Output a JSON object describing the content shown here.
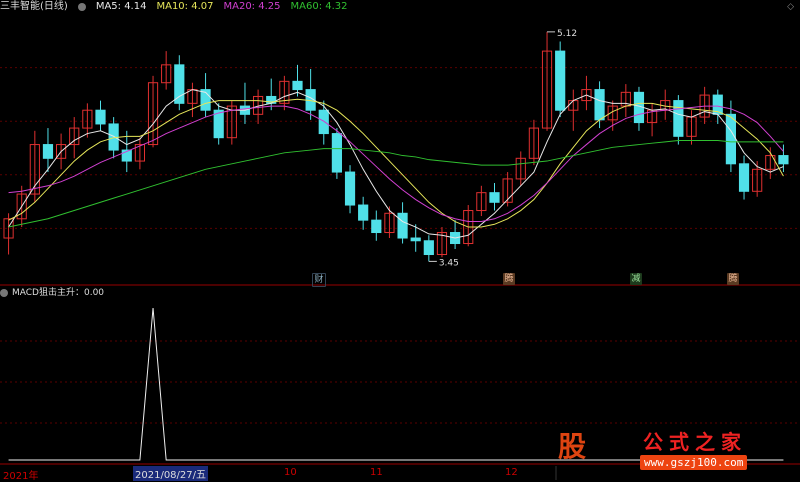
{
  "header": {
    "title": "三丰智能(日线)",
    "ma": [
      {
        "label": "MA5: 4.14",
        "color": "#e8e8e8"
      },
      {
        "label": "MA10: 4.07",
        "color": "#e6e65a"
      },
      {
        "label": "MA20: 4.25",
        "color": "#d040d0"
      },
      {
        "label": "MA60: 4.32",
        "color": "#30c030"
      }
    ]
  },
  "indicator_header": "MACD狙击主升：0.00",
  "markers": [
    "财",
    "腾",
    "减",
    "腾"
  ],
  "x_axis": {
    "labels": [
      "2021年",
      "10",
      "11",
      "12"
    ],
    "selected": "2021/08/27/五"
  },
  "price_annotations": {
    "high": "5.12",
    "low": "3.45"
  },
  "watermark": {
    "logo": "股",
    "title": "公式之家",
    "url": "www.gszj100.com"
  },
  "colors": {
    "up": "#e03030",
    "down": "#50e0e8",
    "bg": "#000000",
    "grid": "#5a0000"
  },
  "chart_data": [
    {
      "type": "candlestick",
      "title": "三丰智能(日线)",
      "ylim": [
        3.3,
        5.25
      ],
      "candles": [
        {
          "o": 3.62,
          "h": 3.8,
          "l": 3.5,
          "c": 3.76
        },
        {
          "o": 3.76,
          "h": 4.0,
          "l": 3.7,
          "c": 3.94
        },
        {
          "o": 3.94,
          "h": 4.4,
          "l": 3.88,
          "c": 4.3
        },
        {
          "o": 4.3,
          "h": 4.42,
          "l": 4.1,
          "c": 4.2
        },
        {
          "o": 4.2,
          "h": 4.38,
          "l": 4.12,
          "c": 4.3
        },
        {
          "o": 4.3,
          "h": 4.5,
          "l": 4.2,
          "c": 4.42
        },
        {
          "o": 4.42,
          "h": 4.6,
          "l": 4.35,
          "c": 4.55
        },
        {
          "o": 4.55,
          "h": 4.62,
          "l": 4.4,
          "c": 4.45
        },
        {
          "o": 4.45,
          "h": 4.5,
          "l": 4.2,
          "c": 4.26
        },
        {
          "o": 4.26,
          "h": 4.4,
          "l": 4.1,
          "c": 4.18
        },
        {
          "o": 4.18,
          "h": 4.35,
          "l": 4.12,
          "c": 4.3
        },
        {
          "o": 4.3,
          "h": 4.8,
          "l": 4.28,
          "c": 4.75
        },
        {
          "o": 4.75,
          "h": 4.98,
          "l": 4.7,
          "c": 4.88
        },
        {
          "o": 4.88,
          "h": 4.95,
          "l": 4.55,
          "c": 4.6
        },
        {
          "o": 4.6,
          "h": 4.75,
          "l": 4.5,
          "c": 4.7
        },
        {
          "o": 4.7,
          "h": 4.82,
          "l": 4.5,
          "c": 4.55
        },
        {
          "o": 4.55,
          "h": 4.6,
          "l": 4.3,
          "c": 4.35
        },
        {
          "o": 4.35,
          "h": 4.62,
          "l": 4.3,
          "c": 4.58
        },
        {
          "o": 4.58,
          "h": 4.75,
          "l": 4.45,
          "c": 4.52
        },
        {
          "o": 4.52,
          "h": 4.7,
          "l": 4.45,
          "c": 4.65
        },
        {
          "o": 4.65,
          "h": 4.78,
          "l": 4.55,
          "c": 4.6
        },
        {
          "o": 4.6,
          "h": 4.8,
          "l": 4.55,
          "c": 4.76
        },
        {
          "o": 4.76,
          "h": 4.88,
          "l": 4.65,
          "c": 4.7
        },
        {
          "o": 4.7,
          "h": 4.85,
          "l": 4.48,
          "c": 4.55
        },
        {
          "o": 4.55,
          "h": 4.62,
          "l": 4.3,
          "c": 4.38
        },
        {
          "o": 4.38,
          "h": 4.42,
          "l": 4.05,
          "c": 4.1
        },
        {
          "o": 4.1,
          "h": 4.15,
          "l": 3.8,
          "c": 3.86
        },
        {
          "o": 3.86,
          "h": 3.92,
          "l": 3.68,
          "c": 3.75
        },
        {
          "o": 3.75,
          "h": 3.82,
          "l": 3.6,
          "c": 3.66
        },
        {
          "o": 3.66,
          "h": 3.85,
          "l": 3.62,
          "c": 3.8
        },
        {
          "o": 3.8,
          "h": 3.88,
          "l": 3.58,
          "c": 3.62
        },
        {
          "o": 3.62,
          "h": 3.72,
          "l": 3.52,
          "c": 3.6
        },
        {
          "o": 3.6,
          "h": 3.64,
          "l": 3.45,
          "c": 3.5
        },
        {
          "o": 3.5,
          "h": 3.7,
          "l": 3.48,
          "c": 3.66
        },
        {
          "o": 3.66,
          "h": 3.75,
          "l": 3.54,
          "c": 3.58
        },
        {
          "o": 3.58,
          "h": 3.86,
          "l": 3.56,
          "c": 3.82
        },
        {
          "o": 3.82,
          "h": 4.0,
          "l": 3.78,
          "c": 3.95
        },
        {
          "o": 3.95,
          "h": 4.02,
          "l": 3.82,
          "c": 3.88
        },
        {
          "o": 3.88,
          "h": 4.1,
          "l": 3.85,
          "c": 4.05
        },
        {
          "o": 4.05,
          "h": 4.25,
          "l": 4.0,
          "c": 4.2
        },
        {
          "o": 4.2,
          "h": 4.48,
          "l": 4.15,
          "c": 4.42
        },
        {
          "o": 4.42,
          "h": 5.12,
          "l": 4.4,
          "c": 4.98
        },
        {
          "o": 4.98,
          "h": 5.05,
          "l": 4.5,
          "c": 4.55
        },
        {
          "o": 4.55,
          "h": 4.7,
          "l": 4.4,
          "c": 4.62
        },
        {
          "o": 4.62,
          "h": 4.8,
          "l": 4.55,
          "c": 4.7
        },
        {
          "o": 4.7,
          "h": 4.76,
          "l": 4.42,
          "c": 4.48
        },
        {
          "o": 4.48,
          "h": 4.62,
          "l": 4.4,
          "c": 4.58
        },
        {
          "o": 4.58,
          "h": 4.74,
          "l": 4.5,
          "c": 4.68
        },
        {
          "o": 4.68,
          "h": 4.72,
          "l": 4.4,
          "c": 4.46
        },
        {
          "o": 4.46,
          "h": 4.6,
          "l": 4.36,
          "c": 4.55
        },
        {
          "o": 4.55,
          "h": 4.7,
          "l": 4.48,
          "c": 4.62
        },
        {
          "o": 4.62,
          "h": 4.66,
          "l": 4.3,
          "c": 4.36
        },
        {
          "o": 4.36,
          "h": 4.55,
          "l": 4.3,
          "c": 4.5
        },
        {
          "o": 4.5,
          "h": 4.72,
          "l": 4.45,
          "c": 4.66
        },
        {
          "o": 4.66,
          "h": 4.7,
          "l": 4.45,
          "c": 4.52
        },
        {
          "o": 4.52,
          "h": 4.62,
          "l": 4.1,
          "c": 4.16
        },
        {
          "o": 4.16,
          "h": 4.22,
          "l": 3.9,
          "c": 3.96
        },
        {
          "o": 3.96,
          "h": 4.18,
          "l": 3.92,
          "c": 4.12
        },
        {
          "o": 4.12,
          "h": 4.28,
          "l": 4.05,
          "c": 4.22
        },
        {
          "o": 4.22,
          "h": 4.3,
          "l": 4.1,
          "c": 4.16
        }
      ],
      "series": [
        {
          "name": "MA5",
          "values": [
            3.7,
            3.85,
            4.0,
            4.12,
            4.25,
            4.33,
            4.38,
            4.4,
            4.36,
            4.3,
            4.34,
            4.45,
            4.58,
            4.65,
            4.7,
            4.68,
            4.58,
            4.55,
            4.55,
            4.58,
            4.6,
            4.65,
            4.68,
            4.64,
            4.58,
            4.46,
            4.3,
            4.12,
            3.96,
            3.82,
            3.74,
            3.7,
            3.65,
            3.64,
            3.62,
            3.64,
            3.72,
            3.8,
            3.9,
            4.0,
            4.1,
            4.32,
            4.52,
            4.62,
            4.66,
            4.62,
            4.6,
            4.6,
            4.58,
            4.55,
            4.56,
            4.52,
            4.5,
            4.54,
            4.52,
            4.4,
            4.24,
            4.14,
            4.1,
            4.14
          ]
        },
        {
          "name": "MA10",
          "values": [
            3.75,
            3.8,
            3.88,
            3.98,
            4.08,
            4.18,
            4.26,
            4.32,
            4.35,
            4.36,
            4.36,
            4.4,
            4.46,
            4.52,
            4.56,
            4.6,
            4.62,
            4.62,
            4.62,
            4.62,
            4.61,
            4.62,
            4.63,
            4.62,
            4.6,
            4.55,
            4.47,
            4.38,
            4.28,
            4.18,
            4.08,
            3.98,
            3.88,
            3.8,
            3.74,
            3.7,
            3.7,
            3.72,
            3.76,
            3.82,
            3.9,
            4.02,
            4.16,
            4.28,
            4.4,
            4.48,
            4.54,
            4.58,
            4.6,
            4.6,
            4.58,
            4.57,
            4.56,
            4.55,
            4.54,
            4.5,
            4.42,
            4.34,
            4.24,
            4.07
          ]
        },
        {
          "name": "MA20",
          "values": [
            3.95,
            3.96,
            3.98,
            4.0,
            4.03,
            4.07,
            4.12,
            4.17,
            4.21,
            4.25,
            4.29,
            4.33,
            4.38,
            4.42,
            4.46,
            4.5,
            4.53,
            4.55,
            4.56,
            4.57,
            4.58,
            4.58,
            4.56,
            4.52,
            4.47,
            4.4,
            4.32,
            4.23,
            4.14,
            4.05,
            3.97,
            3.9,
            3.84,
            3.79,
            3.76,
            3.74,
            3.74,
            3.76,
            3.8,
            3.86,
            3.93,
            4.02,
            4.12,
            4.22,
            4.3,
            4.38,
            4.44,
            4.49,
            4.52,
            4.54,
            4.55,
            4.56,
            4.57,
            4.58,
            4.58,
            4.56,
            4.52,
            4.46,
            4.36,
            4.25
          ]
        },
        {
          "name": "MA60",
          "values": [
            3.7,
            3.72,
            3.74,
            3.76,
            3.79,
            3.82,
            3.85,
            3.88,
            3.91,
            3.94,
            3.97,
            4.0,
            4.03,
            4.06,
            4.09,
            4.12,
            4.14,
            4.16,
            4.18,
            4.2,
            4.22,
            4.24,
            4.25,
            4.26,
            4.27,
            4.27,
            4.27,
            4.26,
            4.25,
            4.24,
            4.22,
            4.21,
            4.19,
            4.18,
            4.17,
            4.16,
            4.15,
            4.15,
            4.15,
            4.16,
            4.17,
            4.18,
            4.2,
            4.22,
            4.24,
            4.26,
            4.28,
            4.29,
            4.3,
            4.31,
            4.32,
            4.33,
            4.33,
            4.33,
            4.33,
            4.32,
            4.32,
            4.32,
            4.32,
            4.32
          ]
        }
      ]
    },
    {
      "type": "line",
      "title": "MACD狙击主升",
      "ylim": [
        0,
        1
      ],
      "series": [
        {
          "name": "MACD狙击主升",
          "values": [
            0,
            0,
            0,
            0,
            0,
            0,
            0,
            0,
            0,
            0,
            0,
            1,
            0,
            0,
            0,
            0,
            0,
            0,
            0,
            0,
            0,
            0,
            0,
            0,
            0,
            0,
            0,
            0,
            0,
            0,
            0,
            0,
            0,
            0,
            0,
            0,
            0,
            0,
            0,
            0,
            0,
            0,
            0,
            0,
            0,
            0,
            0,
            0,
            0,
            0,
            0,
            0,
            0,
            0,
            0,
            0,
            0,
            0,
            0,
            0
          ]
        }
      ]
    }
  ]
}
